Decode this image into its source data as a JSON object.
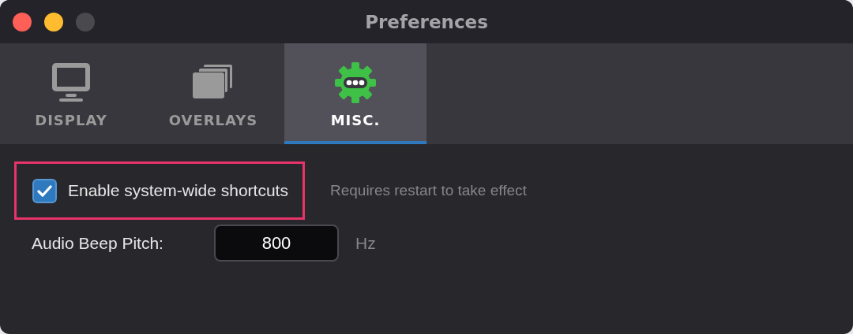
{
  "window": {
    "title": "Preferences",
    "controls": [
      {
        "kind": "close",
        "disabled": false
      },
      {
        "kind": "minimize",
        "disabled": false
      },
      {
        "kind": "zoom",
        "disabled": true
      }
    ]
  },
  "tabs": [
    {
      "kind": "display",
      "label": "DISPLAY",
      "selected": false
    },
    {
      "kind": "overlays",
      "label": "OVERLAYS",
      "selected": false
    },
    {
      "kind": "misc",
      "label": "MISC.",
      "selected": true
    }
  ],
  "options": [
    {
      "kind": "checkbox",
      "label": "Enable system-wide shortcuts",
      "checked": true,
      "highlighted": true,
      "note": "Requires restart to take effect"
    },
    {
      "kind": "number",
      "label": "Audio Beep Pitch:",
      "value": "800",
      "unit": "Hz"
    }
  ]
}
